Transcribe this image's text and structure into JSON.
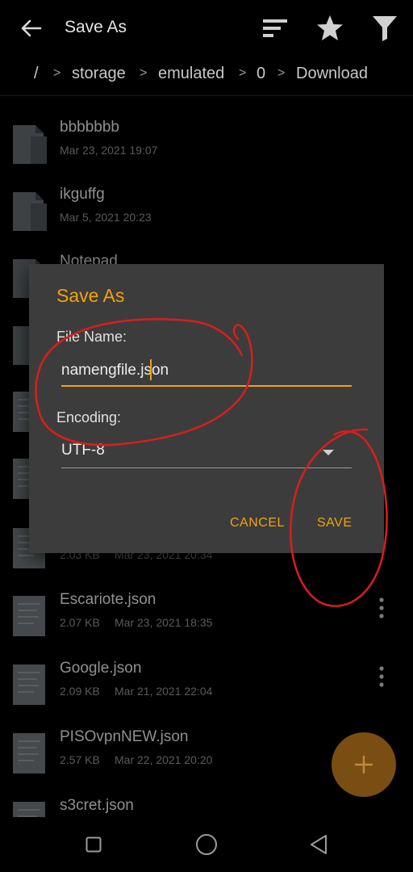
{
  "appbar": {
    "title": "Save As",
    "icons": [
      "back-arrow-icon",
      "sort-icon",
      "star-icon",
      "filter-icon"
    ]
  },
  "breadcrumb": [
    "/",
    "storage",
    "emulated",
    "0",
    "Download"
  ],
  "files": [
    {
      "name": "bbbbbbb",
      "size": "",
      "date": "Mar 23, 2021 19:07",
      "type": "folder"
    },
    {
      "name": "ikguffg",
      "size": "",
      "date": "Mar 5, 2021 20:23",
      "type": "folder"
    },
    {
      "name": "Notepad",
      "size": "",
      "date": "",
      "type": "folder"
    },
    {
      "name": "",
      "size": "",
      "date": "",
      "type": "folder"
    },
    {
      "name": "",
      "size": "",
      "date": "",
      "type": "file"
    },
    {
      "name": "",
      "size": "",
      "date": "",
      "type": "file"
    },
    {
      "name": "",
      "size": "2.03 KB",
      "date": "Mar 23, 2021 20:34",
      "type": "file"
    },
    {
      "name": "Escariote.json",
      "size": "2.07 KB",
      "date": "Mar 23, 2021 18:35",
      "type": "file"
    },
    {
      "name": "Google.json",
      "size": "2.09 KB",
      "date": "Mar 21, 2021 22:04",
      "type": "file"
    },
    {
      "name": "PISOvpnNEW.json",
      "size": "2.57 KB",
      "date": "Mar 22, 2021 20:20",
      "type": "file"
    },
    {
      "name": "s3cret.json",
      "size": "",
      "date": "",
      "type": "file"
    }
  ],
  "dialog": {
    "title": "Save As",
    "file_name_label": "File Name:",
    "file_name_value": "namengfile.json",
    "encoding_label": "Encoding:",
    "encoding_value": "UTF-8",
    "cancel_label": "CANCEL",
    "save_label": "SAVE"
  },
  "fab": {
    "icon": "plus-icon"
  },
  "navbar": {
    "icons": [
      "recents-icon",
      "home-icon",
      "back-icon"
    ]
  },
  "colors": {
    "accent": "#f0a30a",
    "dialog_bg": "#3c3c3c",
    "fab": "#7a4d12",
    "annotation": "#d81e1e"
  }
}
